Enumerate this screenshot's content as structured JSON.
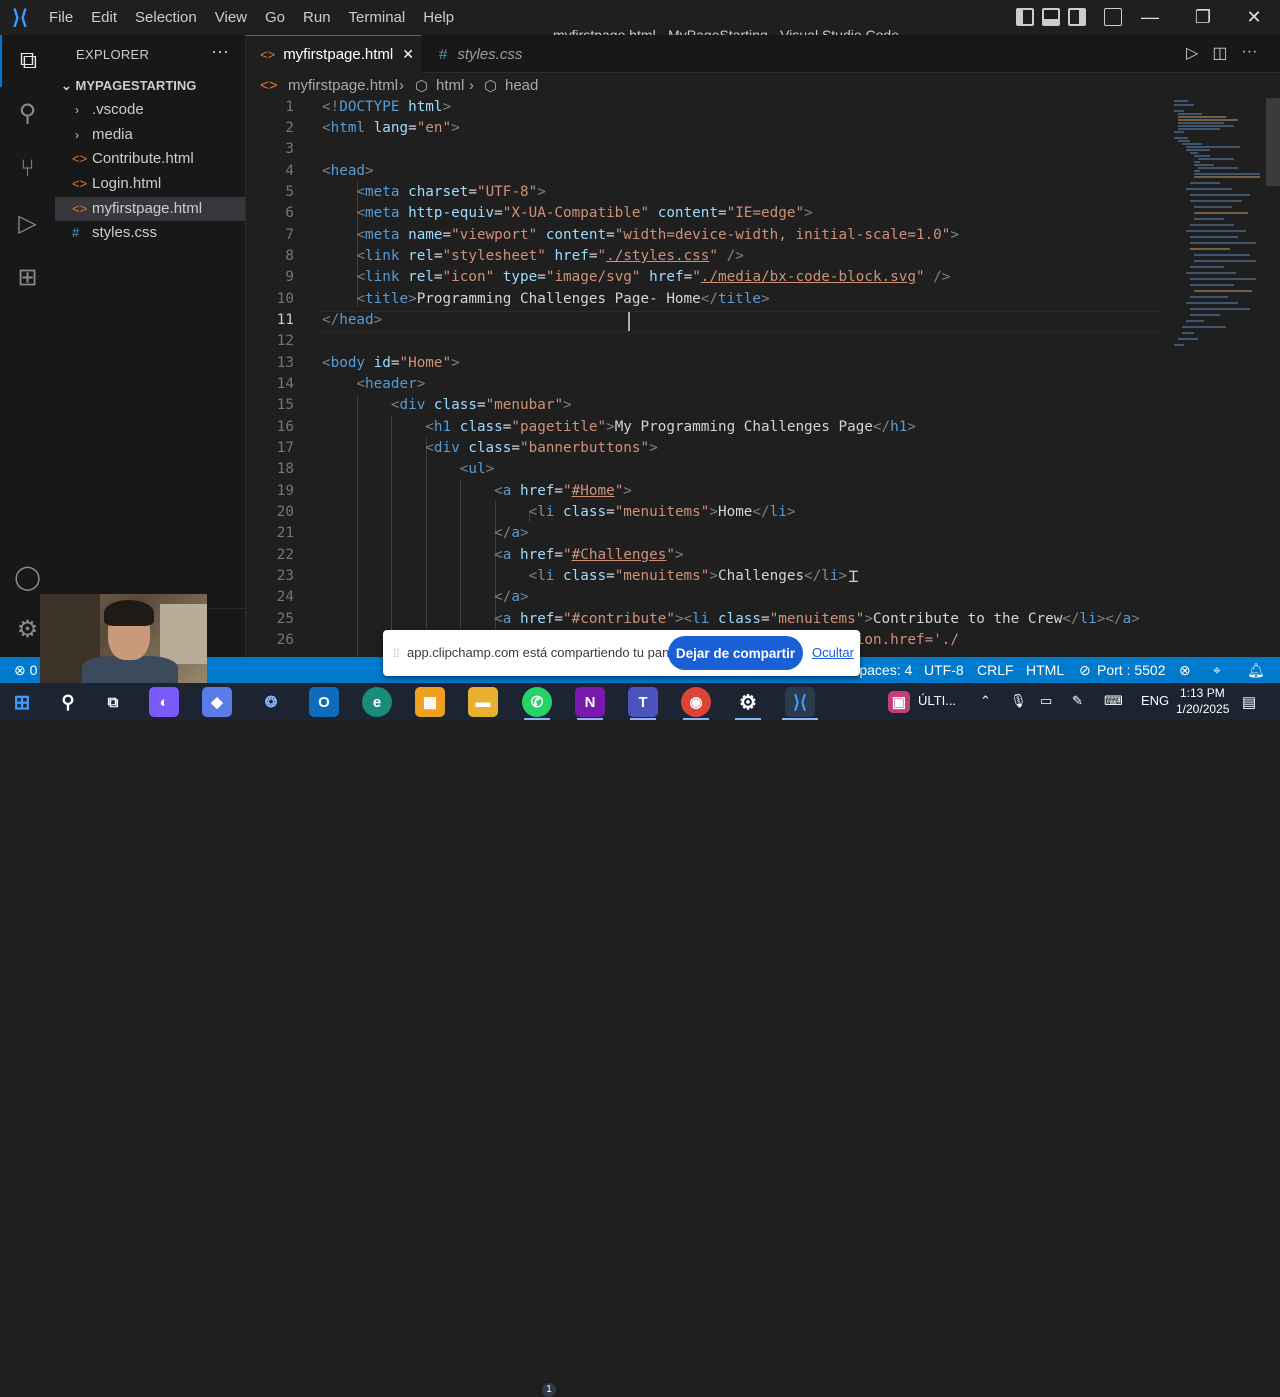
{
  "window": {
    "title": "myfirstpage.html - MyPageStarting - Visual Studio Code",
    "menu": [
      "File",
      "Edit",
      "Selection",
      "View",
      "Go",
      "Run",
      "Terminal",
      "Help"
    ]
  },
  "sidebar": {
    "header": "EXPLORER",
    "folder": "MYPAGESTARTING",
    "items": [
      {
        "label": ".vscode",
        "type": "folder"
      },
      {
        "label": "media",
        "type": "folder"
      },
      {
        "label": "Contribute.html",
        "type": "html"
      },
      {
        "label": "Login.html",
        "type": "html"
      },
      {
        "label": "myfirstpage.html",
        "type": "html",
        "selected": true
      },
      {
        "label": "styles.css",
        "type": "css"
      }
    ]
  },
  "tabs": [
    {
      "label": "myfirstpage.html",
      "active": true
    },
    {
      "label": "styles.css",
      "active": false
    }
  ],
  "breadcrumb": [
    "myfirstpage.html",
    "html",
    "head"
  ],
  "editor": {
    "line_numbers": [
      "1",
      "2",
      "3",
      "4",
      "5",
      "6",
      "7",
      "8",
      "9",
      "10",
      "11",
      "12",
      "13",
      "14",
      "15",
      "16",
      "17",
      "18",
      "19",
      "20",
      "21",
      "22",
      "23",
      "24",
      "25",
      "26"
    ],
    "current_line": "11"
  },
  "statusbar": {
    "remote": "⊗ 0",
    "spaces": "Spaces: 4",
    "encoding": "UTF-8",
    "eol": "CRLF",
    "language": "HTML",
    "port": "Port : 5502"
  },
  "share_bar": {
    "message": "app.clipchamp.com está compartiendo tu pantalla.",
    "stop_button": "Dejar de compartir",
    "hide_link": "Ocultar"
  },
  "taskbar": {
    "onenote_badge": "N",
    "whatsapp_badge": "1",
    "tray_app": "ÚLTI...",
    "language": "ENG",
    "time": "1:13 PM",
    "date": "1/20/2025"
  },
  "colors": {
    "accent": "#007acc",
    "tag": "#569cd6",
    "attribute": "#9cdcfe",
    "string": "#ce9178",
    "punctuation": "#808080"
  }
}
